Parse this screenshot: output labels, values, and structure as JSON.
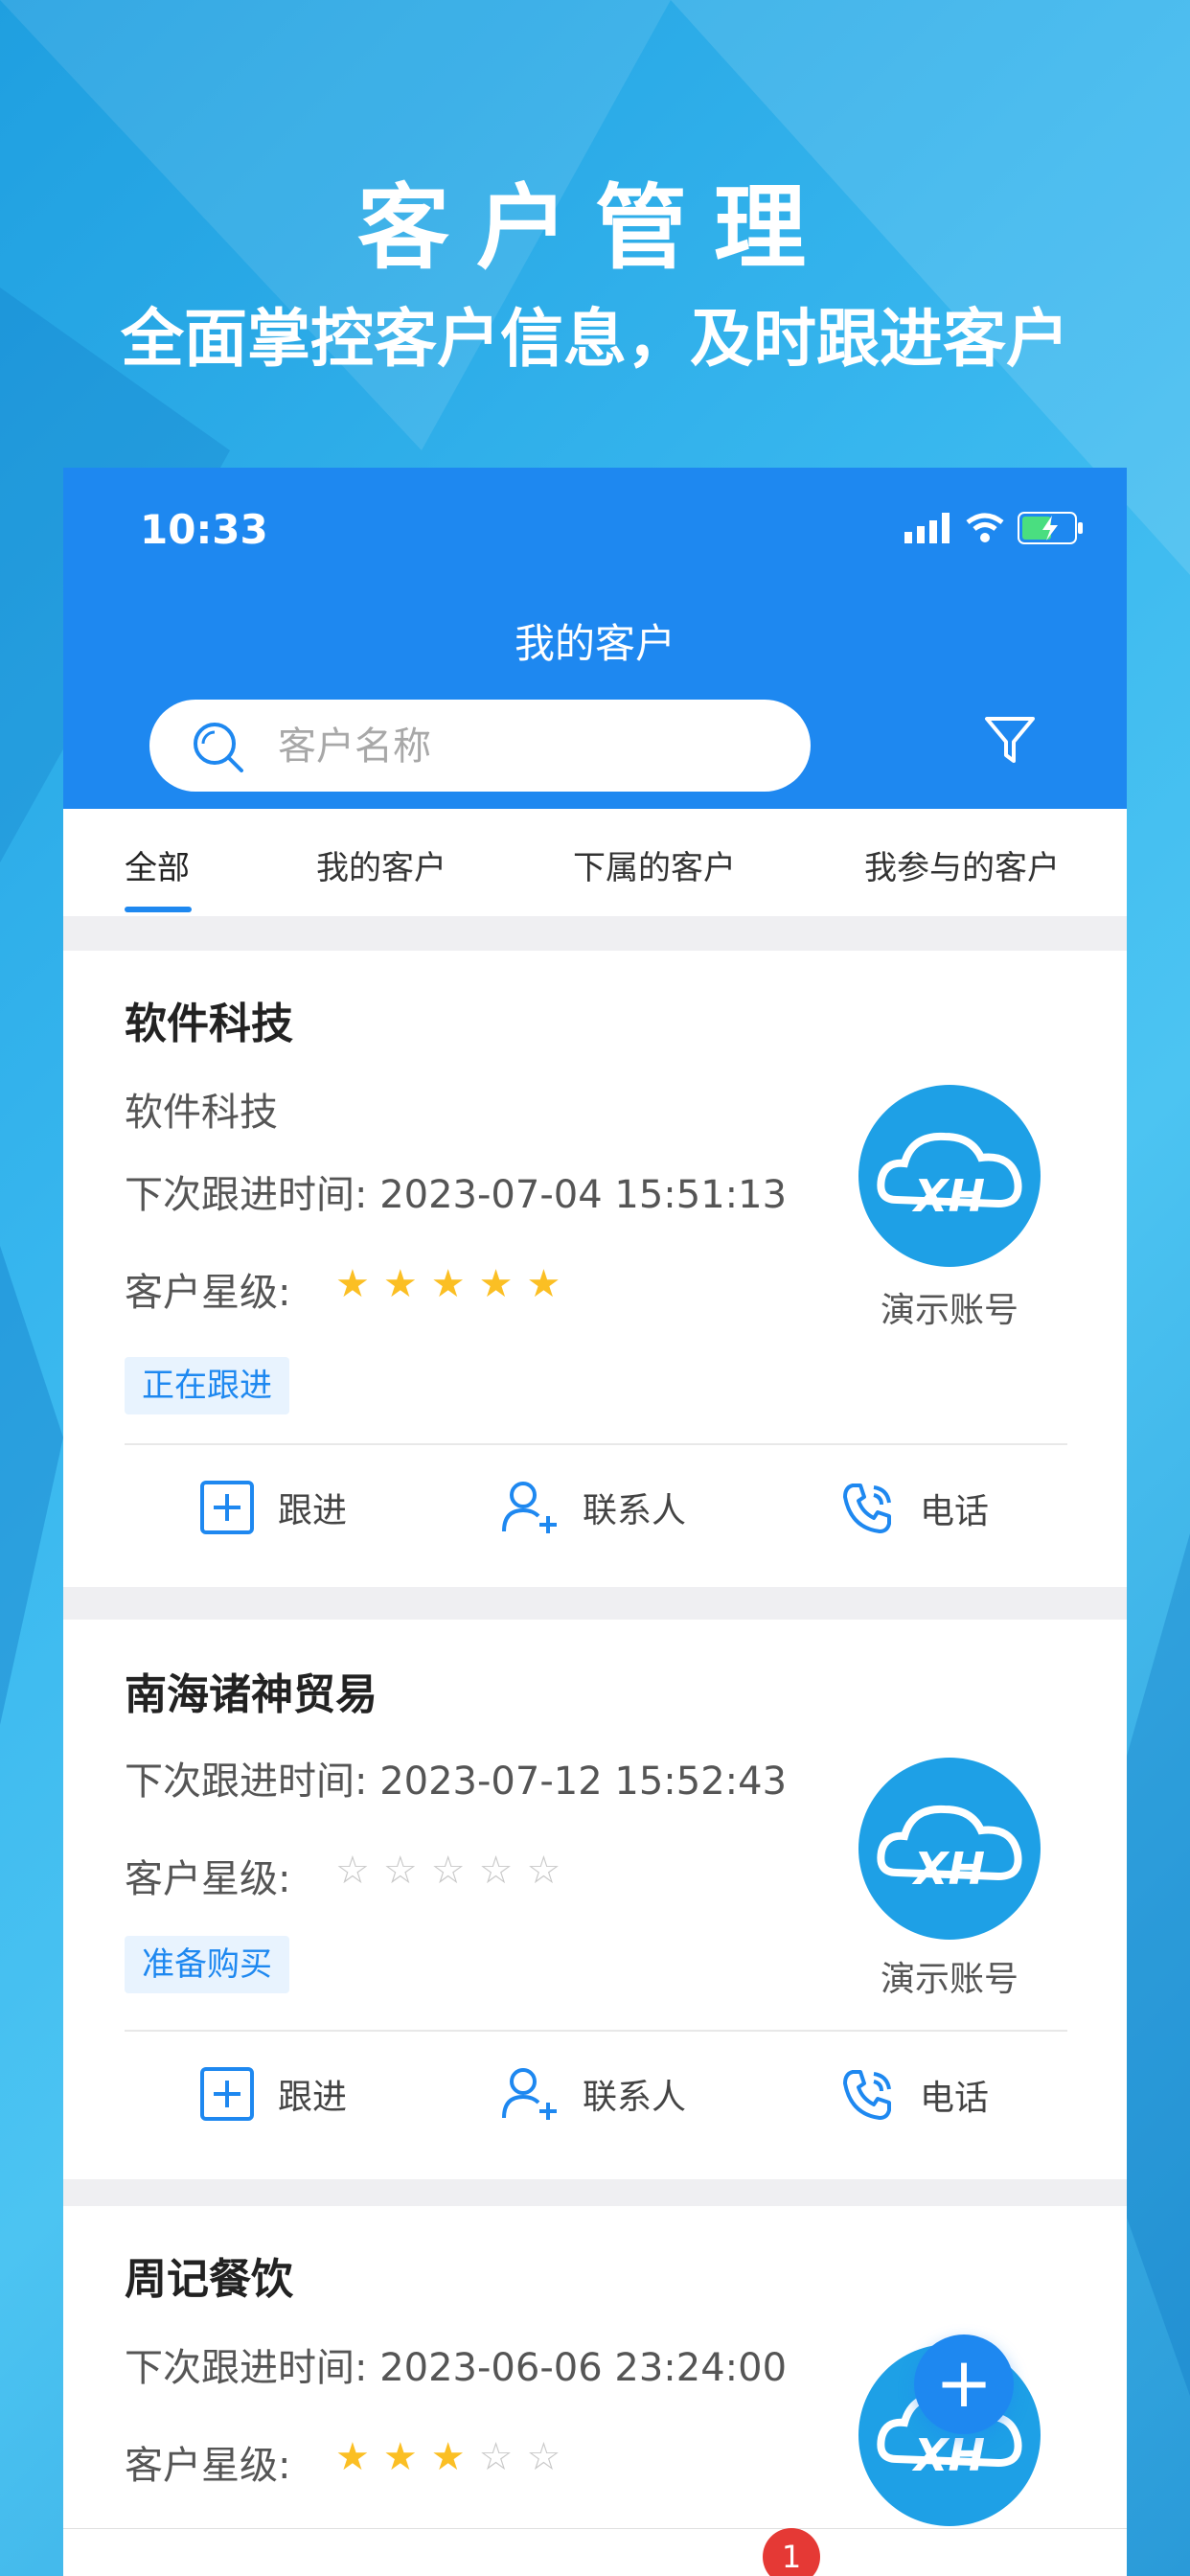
{
  "promo": {
    "title": "客户管理",
    "subtitle": "全面掌控客户信息，及时跟进客户"
  },
  "status_bar": {
    "time": "10:33"
  },
  "header": {
    "title": "我的客户"
  },
  "search": {
    "placeholder": "客户名称",
    "value": ""
  },
  "tabs": [
    {
      "label": "全部",
      "active": true
    },
    {
      "label": "我的客户",
      "active": false
    },
    {
      "label": "下属的客户",
      "active": false
    },
    {
      "label": "我参与的客户",
      "active": false
    }
  ],
  "labels": {
    "next_followup": "下次跟进时间:",
    "rating": "客户星级:",
    "owner": "演示账号",
    "action_followup": "跟进",
    "action_contact": "联系人",
    "action_phone": "电话",
    "logo_text": "XH"
  },
  "customers": [
    {
      "name": "软件科技",
      "subtitle": "软件科技",
      "next_followup_time": "2023-07-04 15:51:13",
      "stars": 5,
      "status": "正在跟进"
    },
    {
      "name": "南海诸神贸易",
      "next_followup_time": "2023-07-12 15:52:43",
      "stars": 0,
      "status": "准备购买"
    },
    {
      "name": "周记餐饮",
      "next_followup_time": "2023-06-06 23:24:00",
      "stars": 3
    }
  ],
  "fab": {
    "label": "+"
  },
  "notification_badge": "1",
  "colors": {
    "primary": "#1e88f0",
    "star": "#fbbf24",
    "logo": "#1ea0e6"
  }
}
